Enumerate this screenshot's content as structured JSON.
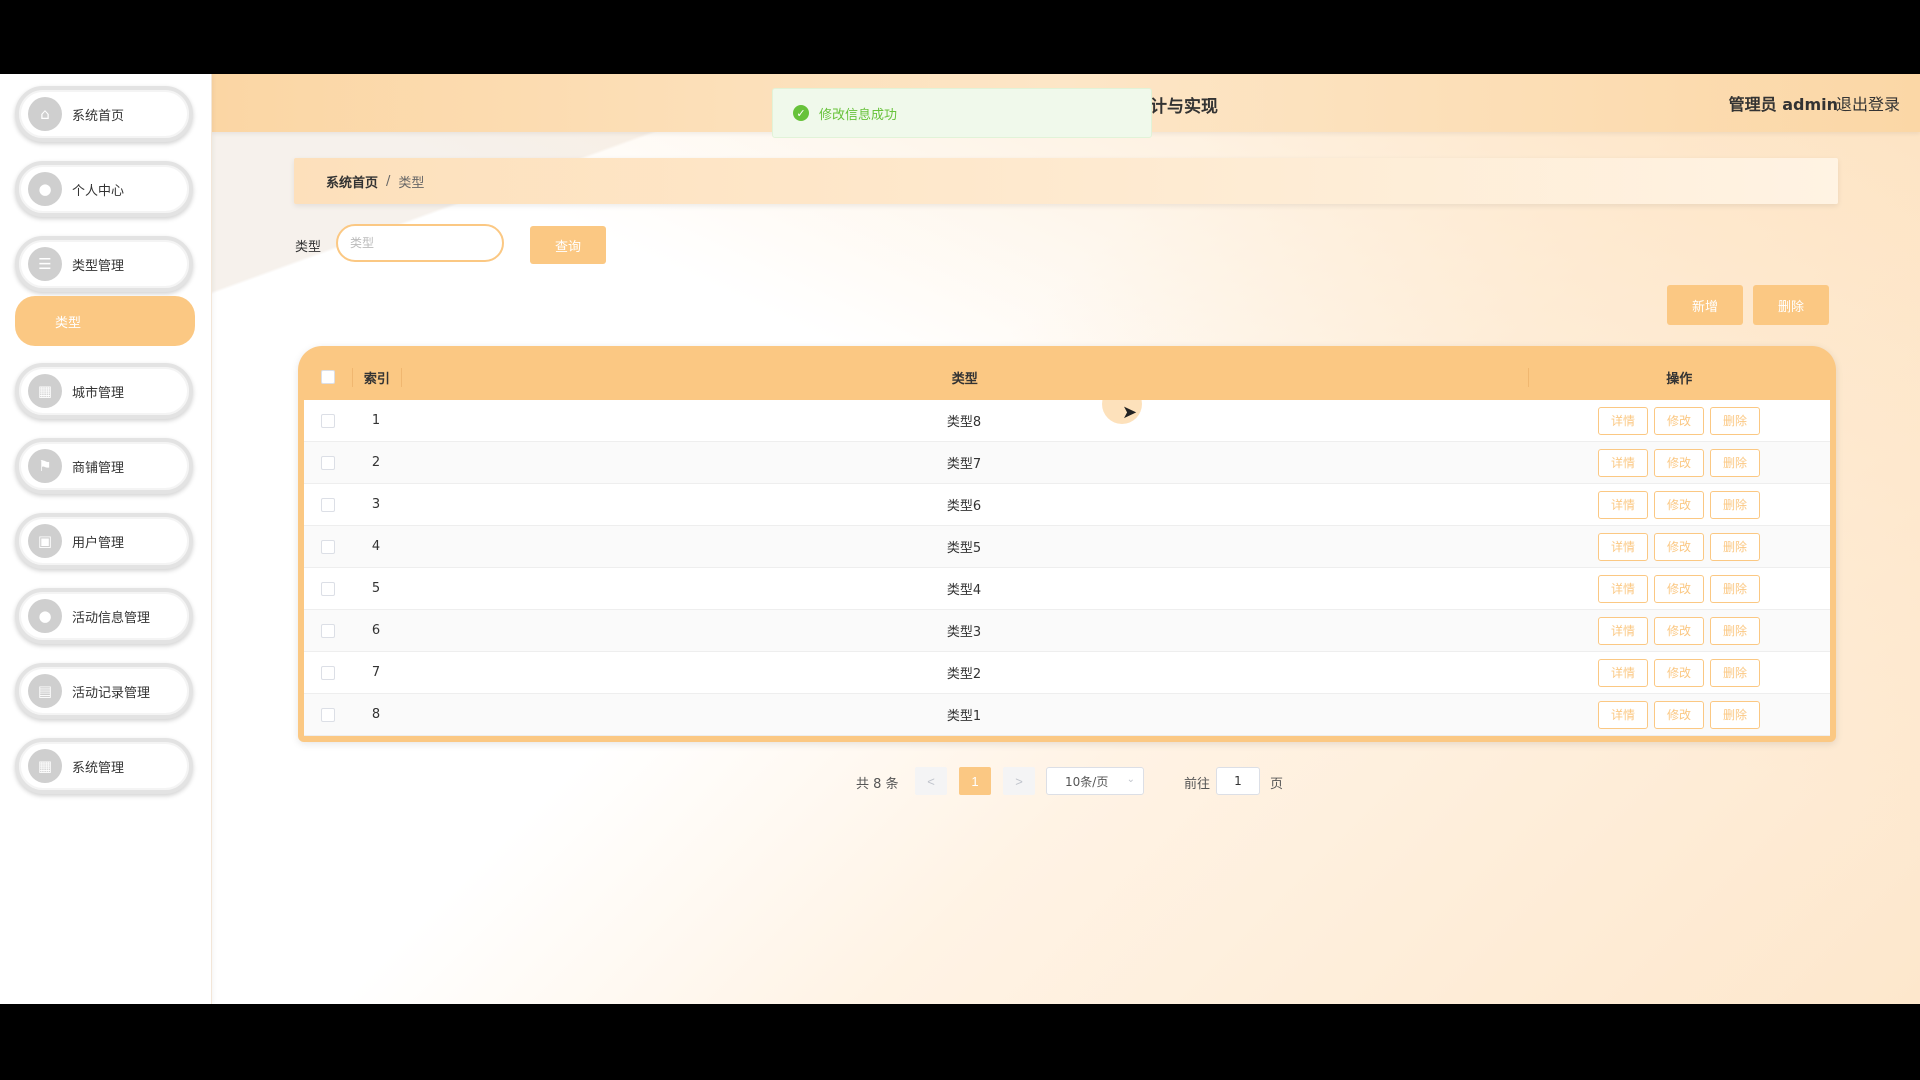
{
  "sidebar": {
    "items": [
      {
        "label": "系统首页",
        "icon": "home-icon"
      },
      {
        "label": "个人中心",
        "icon": "user-icon"
      },
      {
        "label": "类型管理",
        "icon": "list-icon"
      },
      {
        "label": "城市管理",
        "icon": "book-icon"
      },
      {
        "label": "商铺管理",
        "icon": "flag-icon"
      },
      {
        "label": "用户管理",
        "icon": "chat-icon"
      },
      {
        "label": "活动信息管理",
        "icon": "person-icon"
      },
      {
        "label": "活动记录管理",
        "icon": "clipboard-icon"
      },
      {
        "label": "系统管理",
        "icon": "grid-icon"
      }
    ],
    "sub_item": "类型"
  },
  "header": {
    "title": "计与实现",
    "user": "管理员 admin",
    "logout": "退出登录"
  },
  "toast": {
    "message": "修改信息成功"
  },
  "breadcrumb": {
    "home": "系统首页",
    "sep": "/",
    "current": "类型"
  },
  "search": {
    "label": "类型",
    "placeholder": "类型",
    "button": "查询"
  },
  "actions": {
    "add": "新增",
    "delete": "删除"
  },
  "table": {
    "headers": {
      "index": "索引",
      "type": "类型",
      "ops": "操作"
    },
    "rows": [
      {
        "index": "1",
        "type": "类型8"
      },
      {
        "index": "2",
        "type": "类型7"
      },
      {
        "index": "3",
        "type": "类型6"
      },
      {
        "index": "4",
        "type": "类型5"
      },
      {
        "index": "5",
        "type": "类型4"
      },
      {
        "index": "6",
        "type": "类型3"
      },
      {
        "index": "7",
        "type": "类型2"
      },
      {
        "index": "8",
        "type": "类型1"
      }
    ],
    "op_labels": {
      "detail": "详情",
      "edit": "修改",
      "delete": "删除"
    }
  },
  "pagination": {
    "total": "共 8 条",
    "prev": "<",
    "current": "1",
    "next": ">",
    "page_size": "10条/页",
    "goto_label": "前往",
    "goto_value": "1",
    "page_unit": "页"
  },
  "colors": {
    "accent": "#fbc883",
    "success": "#67c23a"
  }
}
